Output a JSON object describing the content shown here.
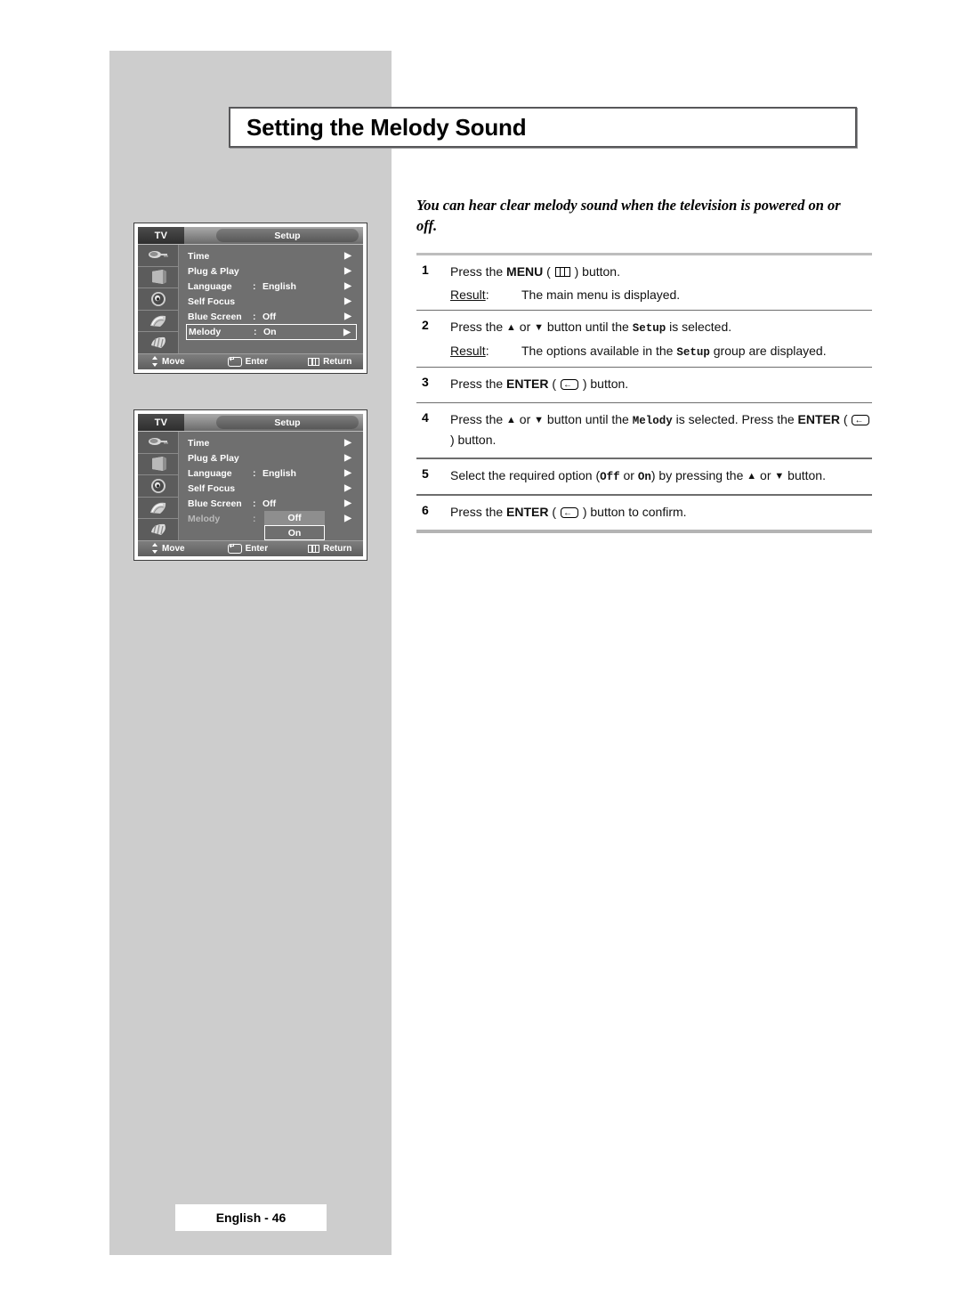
{
  "title": "Setting the Melody Sound",
  "intro": "You can hear clear melody sound when the television is powered on or off.",
  "page_badge": "English - 46",
  "steps": [
    {
      "num": "1",
      "pre": "Press the ",
      "bold": "MENU",
      "icon": "menu-icon",
      "post": " ) button.",
      "open_paren": " ( ",
      "result_label": "Result",
      "result_colon": ":",
      "result_text": "The main menu is displayed."
    },
    {
      "num": "2",
      "pre": "Press the ",
      "up": "▲",
      "mid": " or ",
      "down": "▼",
      "mid2": " button until the ",
      "mono": "Setup",
      "post": " is selected.",
      "result_label": "Result",
      "result_colon": ":",
      "result_pre": "The options available in the ",
      "result_mono": "Setup",
      "result_post": " group are displayed."
    },
    {
      "num": "3",
      "pre": "Press the ",
      "bold": "ENTER",
      "open_paren": " ( ",
      "icon": "enter-icon",
      "post": " ) button."
    },
    {
      "num": "4",
      "pre": "Press the ",
      "up": "▲",
      "mid": " or ",
      "down": "▼",
      "mid2": " button until the ",
      "mono": "Melody",
      "post": " is selected. Press the ",
      "bold2": "ENTER",
      "open_paren2": " ( ",
      "icon": "enter-icon",
      "post2": " ) button."
    },
    {
      "num": "5",
      "pre": "Select the required option (",
      "mono": "Off",
      "mid": " or ",
      "mono2": "On",
      "post": ") by pressing the ",
      "up": "▲",
      "mid2": " or ",
      "down": "▼",
      "post2": " button."
    },
    {
      "num": "6",
      "pre": "Press the ",
      "bold": "ENTER",
      "open_paren": " ( ",
      "icon": "enter-icon",
      "post": " ) button to confirm."
    }
  ],
  "osd": {
    "tv_label": "TV",
    "tab_label": "Setup",
    "icons": [
      "antenna-icon",
      "tv-set-icon",
      "speaker-icon",
      "hand-fan-icon",
      "hand-sound-icon"
    ],
    "footer": {
      "move": "Move",
      "enter": "Enter",
      "return": "Return",
      "move_icon": "up-down-arrows-icon",
      "enter_icon": "enter-key-icon",
      "return_icon": "menu-key-icon"
    },
    "menu1": {
      "rows": [
        {
          "label": "Time",
          "colon": "",
          "value": "",
          "arrow": "▶",
          "selected": false
        },
        {
          "label": "Plug & Play",
          "colon": "",
          "value": "",
          "arrow": "▶",
          "selected": false
        },
        {
          "label": "Language",
          "colon": ":",
          "value": "English",
          "arrow": "▶",
          "selected": false
        },
        {
          "label": "Self Focus",
          "colon": "",
          "value": "",
          "arrow": "▶",
          "selected": false
        },
        {
          "label": "Blue Screen",
          "colon": ":",
          "value": "Off",
          "arrow": "▶",
          "selected": false
        },
        {
          "label": "Melody",
          "colon": ":",
          "value": "On",
          "arrow": "▶",
          "selected": true
        }
      ]
    },
    "menu2": {
      "rows": [
        {
          "label": "Time",
          "colon": "",
          "value": "",
          "arrow": "▶",
          "dim": false
        },
        {
          "label": "Plug & Play",
          "colon": "",
          "value": "",
          "arrow": "▶",
          "dim": false
        },
        {
          "label": "Language",
          "colon": ":",
          "value": "English",
          "arrow": "▶",
          "dim": false
        },
        {
          "label": "Self Focus",
          "colon": "",
          "value": "",
          "arrow": "▶",
          "dim": false
        },
        {
          "label": "Blue Screen",
          "colon": ":",
          "value": "Off",
          "arrow": "▶",
          "dim": false
        },
        {
          "label": "Melody",
          "colon": ":",
          "value": "",
          "arrow": "▶",
          "dim": true
        }
      ],
      "dropdown": {
        "options": [
          {
            "label": "Off",
            "selected": false
          },
          {
            "label": "On",
            "selected": true
          }
        ]
      }
    }
  },
  "colors": {
    "panel_gray": "#cdcdcd",
    "osd_body": "#6f6f6f",
    "osd_icon_col": "#5c5c5c",
    "rule_light": "#bdbdbd",
    "rule_dark": "#6d6d6d"
  }
}
